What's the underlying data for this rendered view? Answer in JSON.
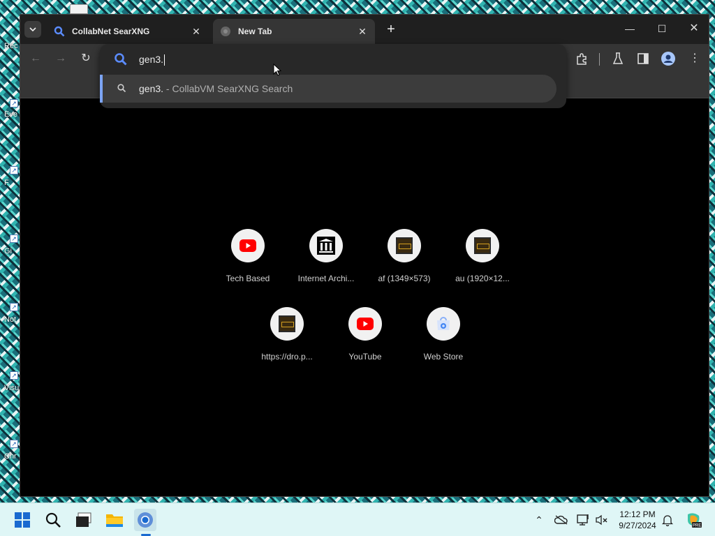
{
  "desktop": {
    "icon_labels": [
      "Rec",
      "Eve",
      "F",
      "Gi",
      "Not",
      "Visu",
      "Chr"
    ]
  },
  "browser": {
    "tabs": [
      {
        "title": "CollabNet SearXNG",
        "favicon": "search-icon",
        "active": false
      },
      {
        "title": "New Tab",
        "favicon": "globe-icon",
        "active": true
      }
    ],
    "omnibox": {
      "input_value": "gen3.",
      "suggestion_query": "gen3.",
      "suggestion_source": " - CollabVM SearXNG Search"
    },
    "shortcuts": [
      {
        "label": "Tech Based",
        "icon": "youtube-icon"
      },
      {
        "label": "Internet Archi...",
        "icon": "archive-icon"
      },
      {
        "label": "af (1349×573)",
        "icon": "image-thumbnail-icon"
      },
      {
        "label": "au (1920×12...",
        "icon": "image-thumbnail-icon"
      },
      {
        "label": "https://dro.p...",
        "icon": "image-thumbnail-icon"
      },
      {
        "label": "YouTube",
        "icon": "youtube-icon"
      },
      {
        "label": "Web Store",
        "icon": "web-store-icon"
      }
    ]
  },
  "taskbar": {
    "time": "12:12 PM",
    "date": "9/27/2024"
  },
  "colors": {
    "omni_accent": "#7ca4f4",
    "youtube_red": "#ff0000",
    "taskbar_bg": "#dff6f6"
  }
}
